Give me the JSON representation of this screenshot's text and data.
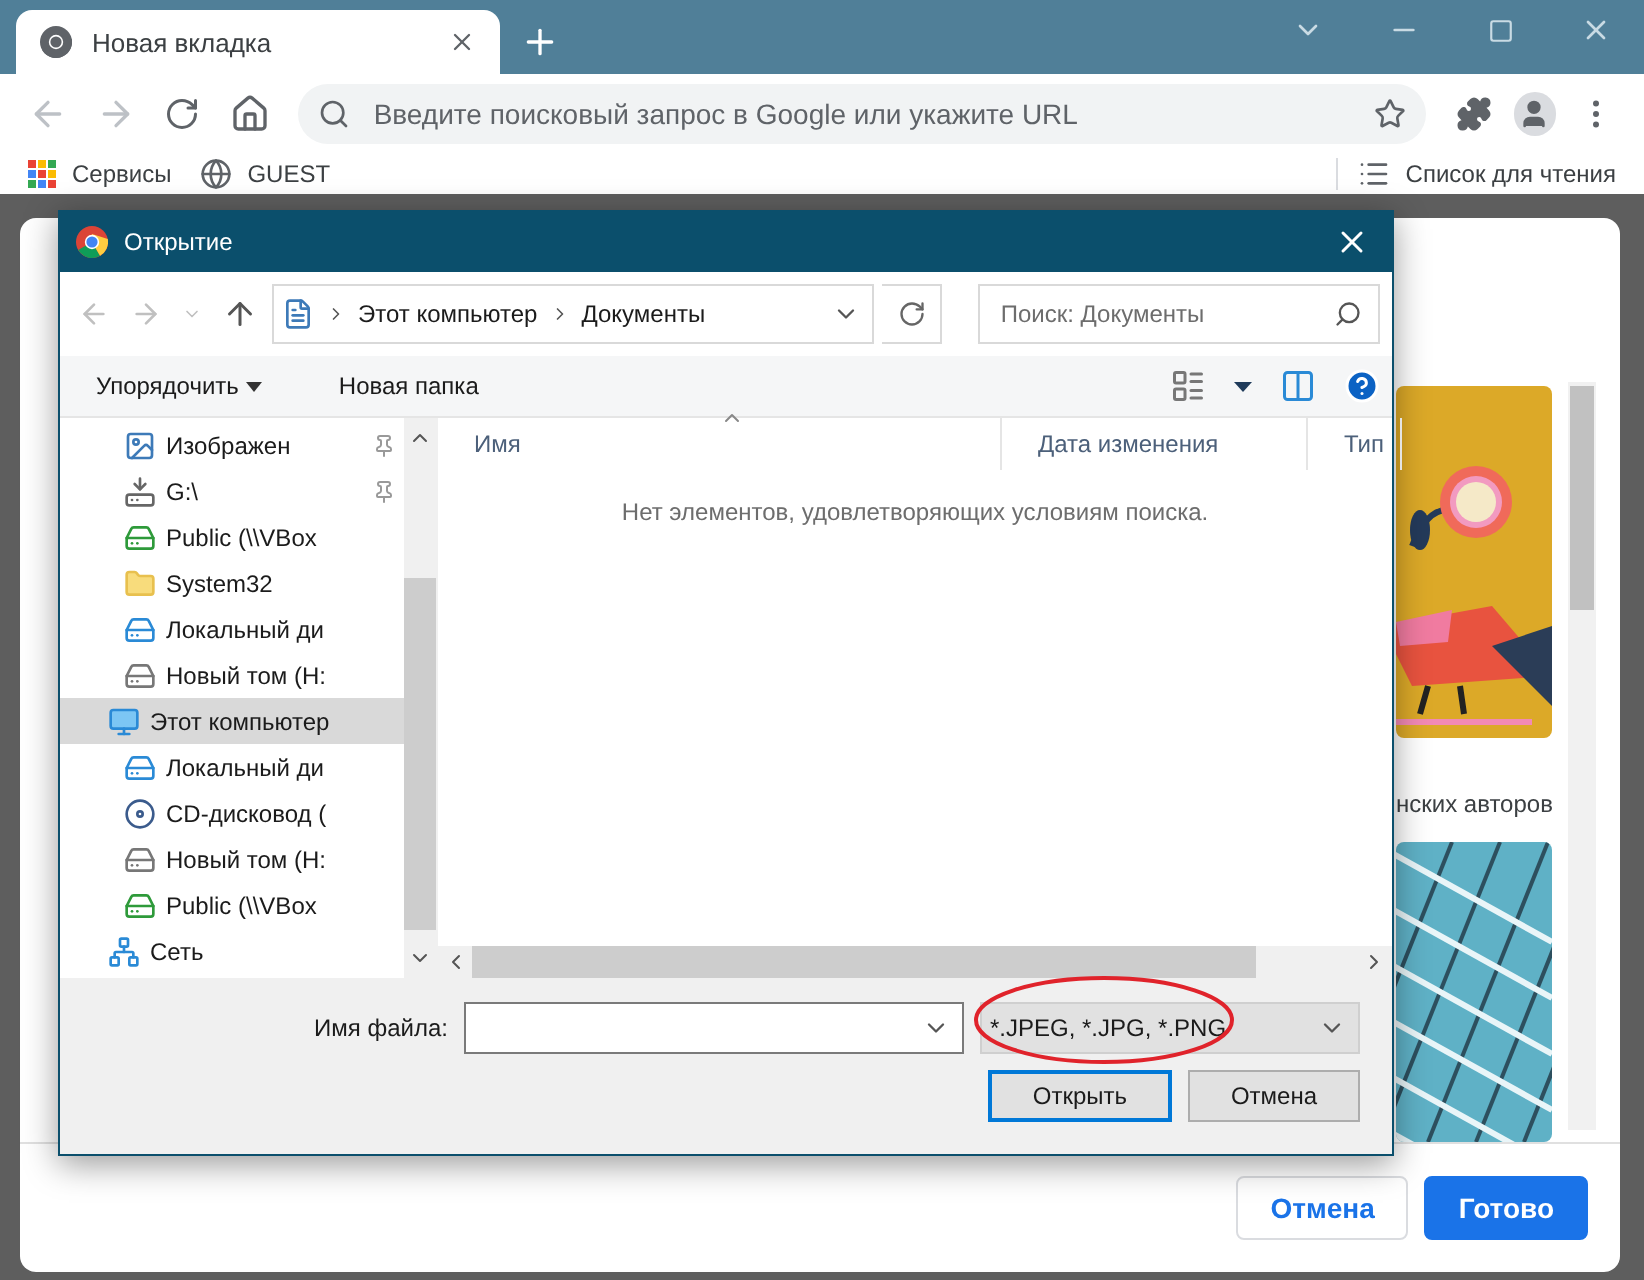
{
  "browser": {
    "tab": {
      "title": "Новая вкладка",
      "selected": true
    },
    "omnibox": {
      "placeholder": "Введите поисковый запрос в Google или укажите URL"
    },
    "bookmarks": [
      {
        "label": "Сервисы",
        "kind": "apps"
      },
      {
        "label": "GUEST",
        "kind": "globe"
      }
    ],
    "reading_list": "Список для чтения"
  },
  "page_modal": {
    "caption": "нских авторов",
    "buttons": [
      {
        "label": "Отмена",
        "kind": "secondary"
      },
      {
        "label": "Готово",
        "kind": "primary"
      }
    ]
  },
  "dialog": {
    "title": "Открытие",
    "breadcrumb": [
      "Этот компьютер",
      "Документы"
    ],
    "search": {
      "placeholder": "Поиск: Документы"
    },
    "commands": [
      {
        "label": "Упорядочить",
        "kind": "menu"
      },
      {
        "label": "Новая папка",
        "kind": "plain"
      }
    ],
    "quick_access": [
      {
        "label": "Изображен",
        "kind": "pictures",
        "pinned": true,
        "selected": false
      },
      {
        "label": "G:\\",
        "kind": "unknown-drive",
        "pinned": true,
        "selected": false
      },
      {
        "label": "Public (\\\\VBox",
        "kind": "network-drive",
        "pinned": false,
        "selected": false
      },
      {
        "label": "System32",
        "kind": "folder",
        "pinned": false,
        "selected": false
      },
      {
        "label": "Локальный ди",
        "kind": "system-drive",
        "pinned": false,
        "selected": false
      },
      {
        "label": "Новый том (H:",
        "kind": "drive",
        "pinned": false,
        "selected": false
      }
    ],
    "tree": [
      {
        "label": "Этот компьютер",
        "kind": "computer",
        "selected": true,
        "children": [
          {
            "label": "Локальный ди",
            "kind": "system-drive",
            "selected": false
          },
          {
            "label": "CD-дисковод (",
            "kind": "cd-drive",
            "selected": false
          },
          {
            "label": "Новый том (H:",
            "kind": "drive",
            "selected": false
          },
          {
            "label": "Public (\\\\VBox",
            "kind": "network-drive",
            "selected": false
          }
        ]
      },
      {
        "label": "Сеть",
        "kind": "network",
        "selected": false
      }
    ],
    "columns": [
      {
        "label": "Имя",
        "sorted": true
      },
      {
        "label": "Дата изменения",
        "sorted": false
      },
      {
        "label": "Тип",
        "sorted": false
      }
    ],
    "empty_message": "Нет элементов, удовлетворяющих условиям поиска.",
    "file_name": {
      "label": "Имя файла:"
    },
    "filter": {
      "value": "*.JPEG, *.JPG, *.PNG",
      "highlighted": true
    },
    "buttons": [
      {
        "label": "Открыть",
        "default": true
      },
      {
        "label": "Отмена",
        "default": false
      }
    ]
  }
}
